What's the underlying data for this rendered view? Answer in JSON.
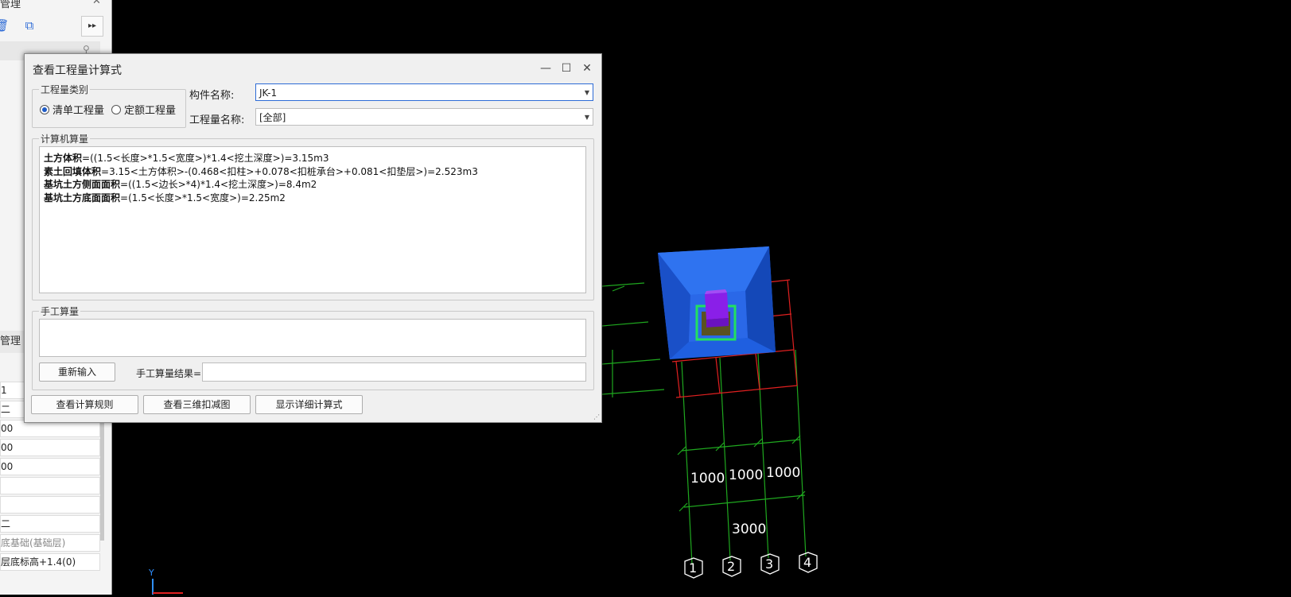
{
  "left_panel": {
    "title": "管理",
    "section_title": "管理",
    "rows": [
      "1",
      "二",
      "00",
      "00",
      "00",
      "",
      "",
      "二",
      "底基础(基础层)",
      "层底标高+1.4(0)"
    ]
  },
  "dialog": {
    "title": "查看工程量计算式",
    "quantity_category": {
      "label": "工程量类别",
      "options": [
        "清单工程量",
        "定额工程量"
      ],
      "selected": "清单工程量"
    },
    "component_label": "构件名称:",
    "component_value": "JK-1",
    "quantity_name_label": "工程量名称:",
    "quantity_name_value": "[全部]",
    "computer_calc": {
      "label": "计算机算量",
      "lines": [
        {
          "name": "土方体积",
          "formula": "=((1.5<长度>*1.5<宽度>)*1.4<挖土深度>)=3.15m3"
        },
        {
          "name": "素土回填体积",
          "formula": "=3.15<土方体积>-(0.468<扣柱>+0.078<扣桩承台>+0.081<扣垫层>)=2.523m3"
        },
        {
          "name": "基坑土方侧面面积",
          "formula": "=((1.5<边长>*4)*1.4<挖土深度>)=8.4m2"
        },
        {
          "name": "基坑土方底面面积",
          "formula": "=(1.5<长度>*1.5<宽度>)=2.25m2"
        }
      ]
    },
    "manual_calc": {
      "label": "手工算量",
      "reinput_button": "重新输入",
      "result_label": "手工算量结果="
    },
    "buttons": {
      "view_rules": "查看计算规则",
      "view_3d": "查看三维扣减图",
      "show_detail": "显示详细计算式"
    }
  },
  "view3d": {
    "dimensions": [
      "1000",
      "1000",
      "1000",
      "3000"
    ],
    "axis_labels": [
      "1",
      "2",
      "3",
      "4"
    ],
    "axis_y": "Y"
  }
}
